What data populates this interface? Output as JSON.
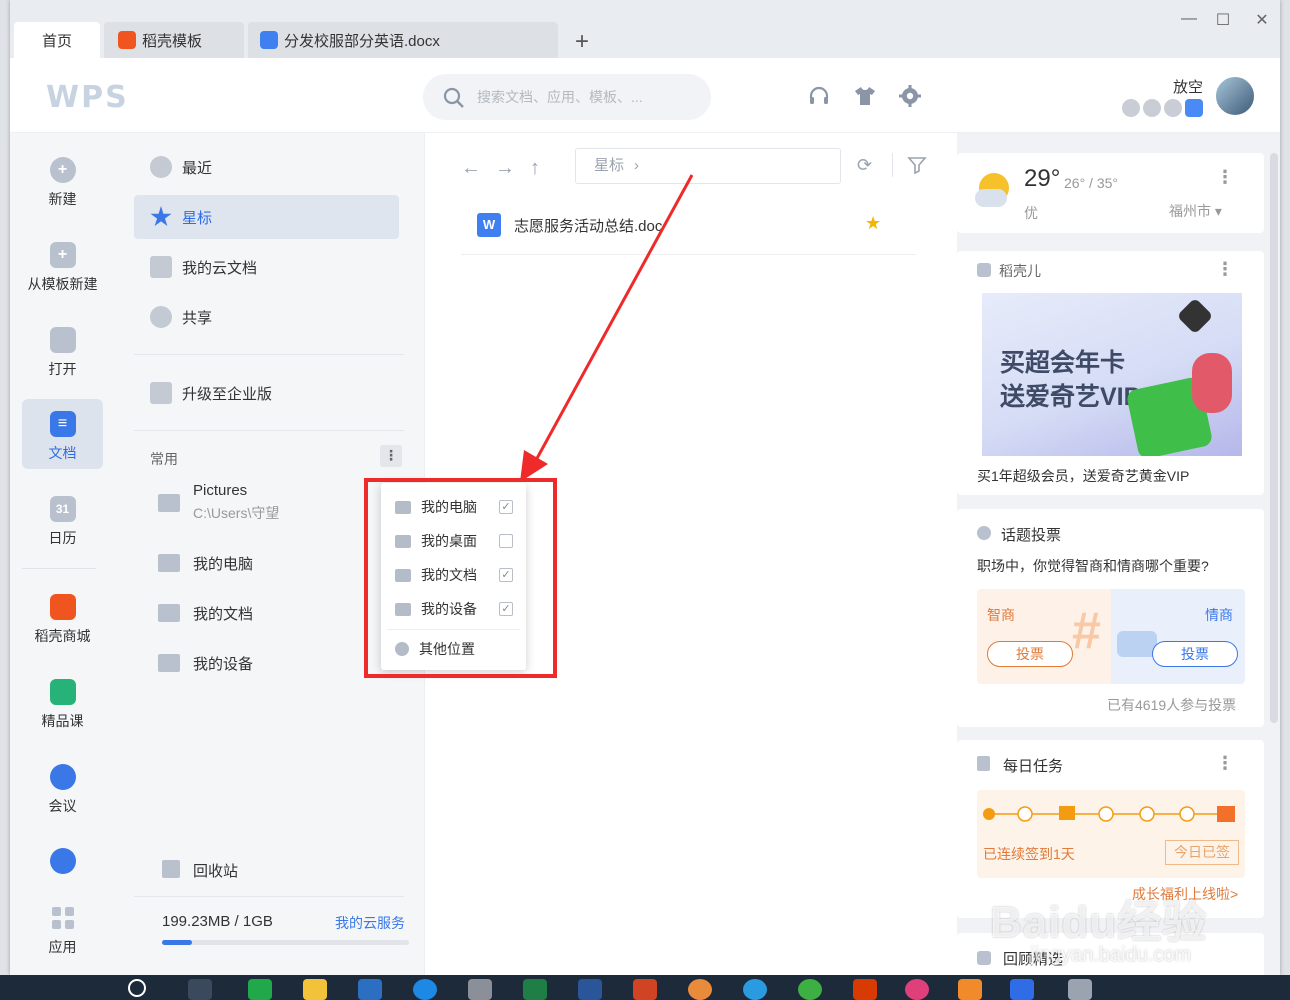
{
  "tabs": [
    {
      "label": "首页",
      "active": true
    },
    {
      "label": "稻壳模板",
      "icon": "docer-icon"
    },
    {
      "label": "分发校服部分英语.docx",
      "icon": "word-icon"
    }
  ],
  "new_tab": "+",
  "header": {
    "logo": "WPS",
    "search_placeholder": "搜索文档、应用、模板、...",
    "username": "放空"
  },
  "leftnav": [
    {
      "label": "新建",
      "icon": "plus-icon"
    },
    {
      "label": "从模板新建",
      "icon": "template-icon"
    },
    {
      "label": "打开",
      "icon": "folder-icon"
    },
    {
      "label": "文档",
      "icon": "document-icon",
      "active": true
    },
    {
      "label": "日历",
      "icon": "calendar-icon",
      "date": "31"
    },
    {
      "label": "稻壳商城",
      "icon": "docer-mall-icon"
    },
    {
      "label": "精品课",
      "icon": "course-icon"
    },
    {
      "label": "会议",
      "icon": "meeting-icon"
    },
    {
      "label": "",
      "icon": "assistant-icon"
    },
    {
      "label": "应用",
      "icon": "apps-icon"
    }
  ],
  "sidebar": {
    "items": [
      {
        "label": "最近",
        "icon": "clock-icon"
      },
      {
        "label": "星标",
        "icon": "star-icon",
        "active": true
      },
      {
        "label": "我的云文档",
        "icon": "cloud-doc-icon"
      },
      {
        "label": "共享",
        "icon": "share-icon"
      },
      {
        "label": "升级至企业版",
        "icon": "enterprise-icon"
      }
    ],
    "common_title": "常用",
    "common_items": [
      {
        "label": "Pictures",
        "sub": "C:\\Users\\守望"
      },
      {
        "label": "我的电脑"
      },
      {
        "label": "我的文档"
      },
      {
        "label": "我的设备"
      }
    ],
    "recycle": "回收站",
    "storage": "199.23MB / 1GB",
    "storage_used_fraction": 0.12,
    "cloud_service": "我的云服务"
  },
  "main": {
    "breadcrumb": "星标",
    "file": {
      "icon_letter": "W",
      "name": "志愿服务活动总结.doc"
    }
  },
  "popup": {
    "items": [
      {
        "label": "我的电脑",
        "checked": true
      },
      {
        "label": "我的桌面",
        "checked": false
      },
      {
        "label": "我的文档",
        "checked": true
      },
      {
        "label": "我的设备",
        "checked": true
      }
    ],
    "other": "其他位置",
    "check_mark": "✓"
  },
  "weather": {
    "temp": "29°",
    "range": "26° / 35°",
    "quality": "优",
    "city": "福州市"
  },
  "docer": {
    "title": "稻壳儿",
    "banner_line1": "买超会年卡",
    "banner_line2": "送爱奇艺VIP",
    "caption": "买1年超级会员，送爱奇艺黄金VIP"
  },
  "vote": {
    "title": "话题投票",
    "question": "职场中，你觉得智商和情商哪个重要?",
    "left": "智商",
    "right": "情商",
    "btn": "投票",
    "participants": "已有4619人参与投票"
  },
  "task": {
    "title": "每日任务",
    "streak": "已连续签到1天",
    "signed": "今日已签",
    "link": "成长福利上线啦>"
  },
  "next_card_title": "回顾精选",
  "watermark": "Baidu经验",
  "watermark_url": "jingyan.baidu.com",
  "colors": {
    "accent": "#3a78e8",
    "arrow": "#ee2a2a",
    "star": "#f5b400",
    "task": "#f39c12"
  }
}
